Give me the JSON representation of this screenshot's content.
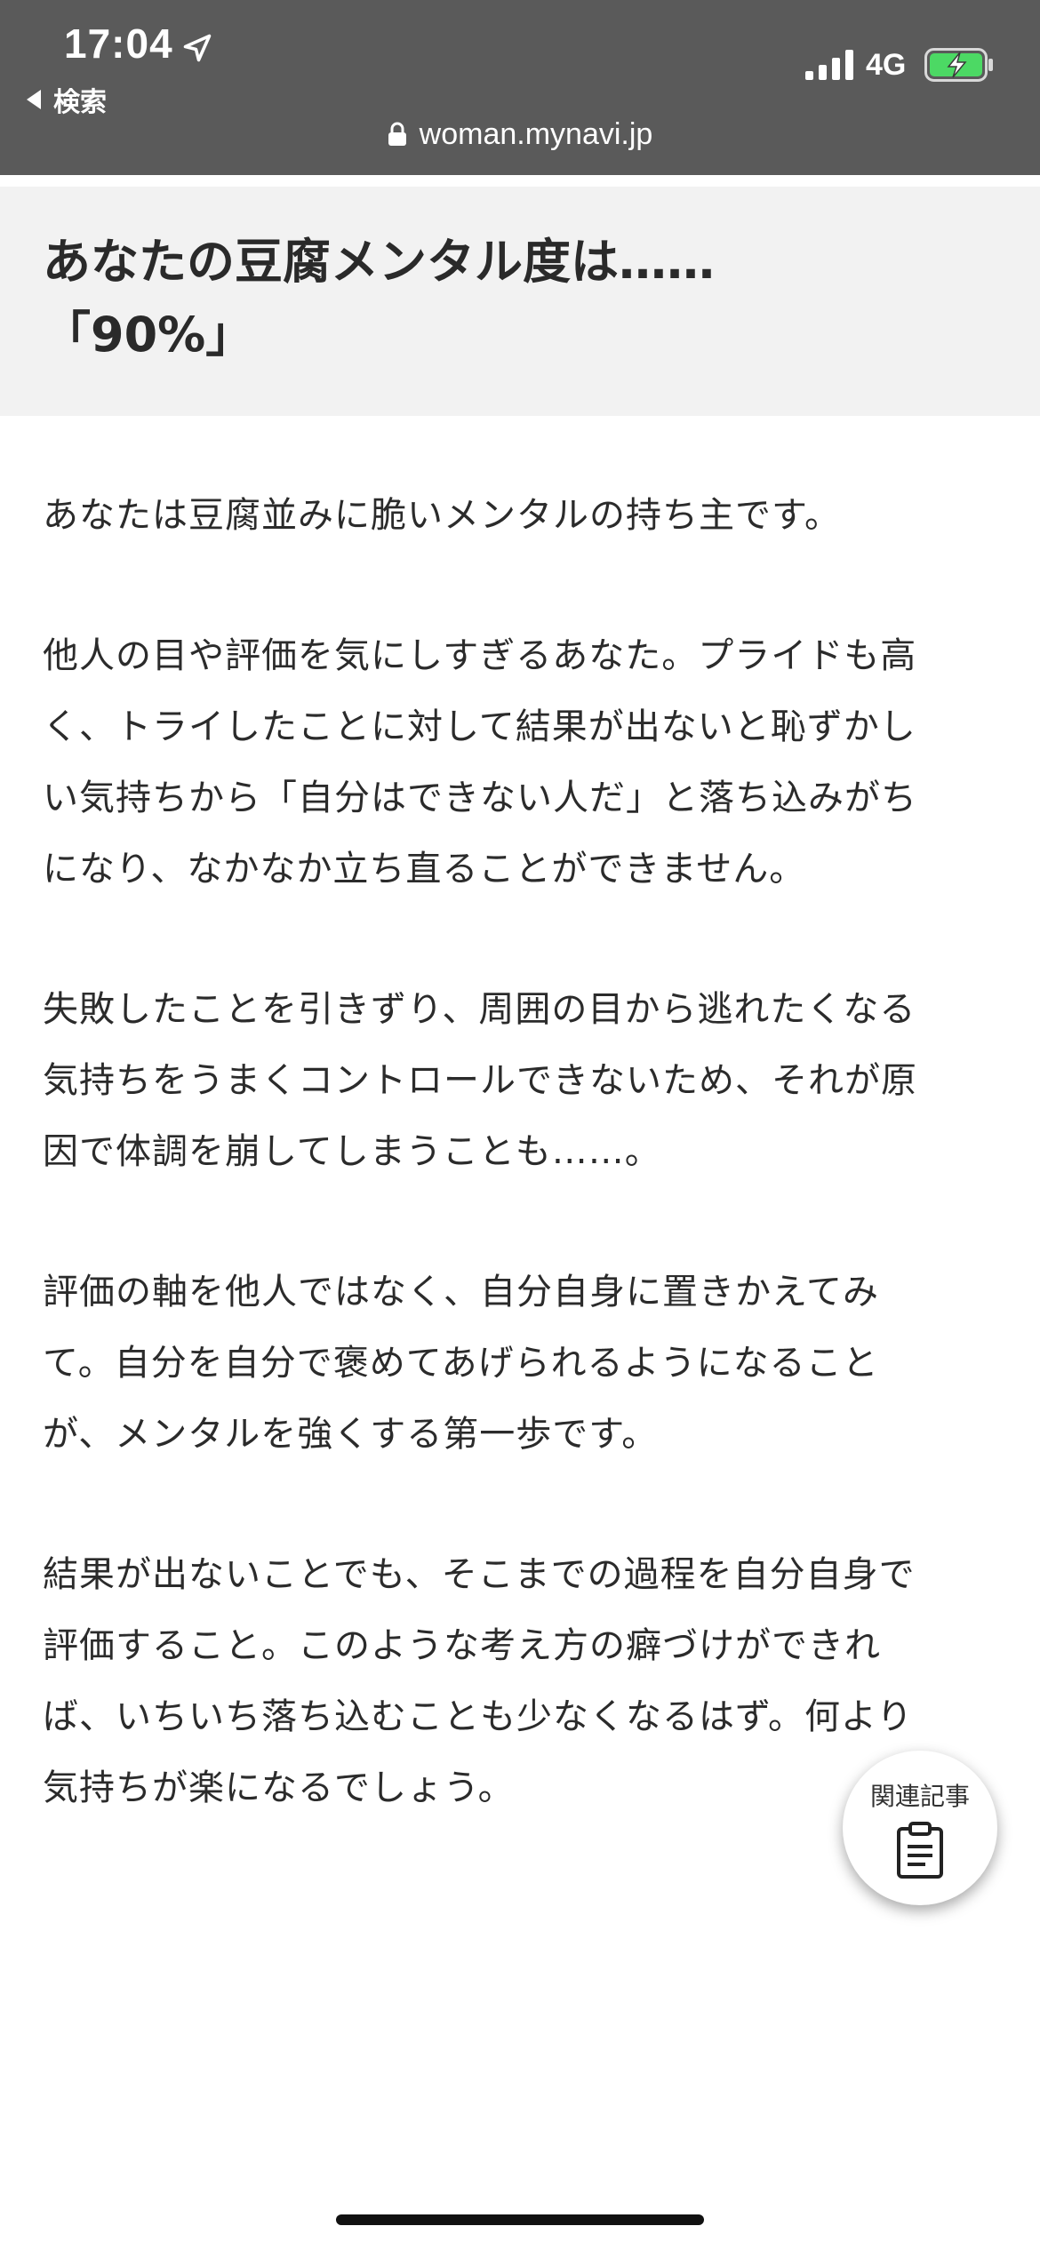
{
  "status_bar": {
    "time": "17:04",
    "network": "4G",
    "back_label": "検索"
  },
  "browser": {
    "url": "woman.mynavi.jp"
  },
  "result": {
    "title_line1": "あなたの豆腐メンタル度は……",
    "title_line2": "「90%」"
  },
  "article": {
    "paragraphs": [
      "あなたは豆腐並みに脆いメンタルの持ち主です。",
      "他人の目や評価を気にしすぎるあなた。プライドも高\nく、トライしたことに対して結果が出ないと恥ずかし\nい気持ちから「自分はできない人だ」と落ち込みがち\nになり、なかなか立ち直ることができません。",
      "失敗したことを引きずり、周囲の目から逃れたくなる\n気持ちをうまくコントロールできないため、それが原\n因で体調を崩してしまうことも……。",
      "評価の軸を他人ではなく、自分自身に置きかえてみ\nて。自分を自分で褒めてあげられるようになること\nが、メンタルを強くする第一歩です。",
      "結果が出ないことでも、そこまでの過程を自分自身で\n評価すること。このような考え方の癖づけができれ\nば、いちいち落ち込むことも少なくなるはず。何より\n気持ちが楽になるでしょう。"
    ]
  },
  "related_button": {
    "label": "関連記事",
    "icon": "clipboard-icon"
  },
  "colors": {
    "topbar": "#5a5a5a",
    "band": "#f2f2f2",
    "text": "#2b2b2b",
    "battery_charge": "#4cd964"
  }
}
